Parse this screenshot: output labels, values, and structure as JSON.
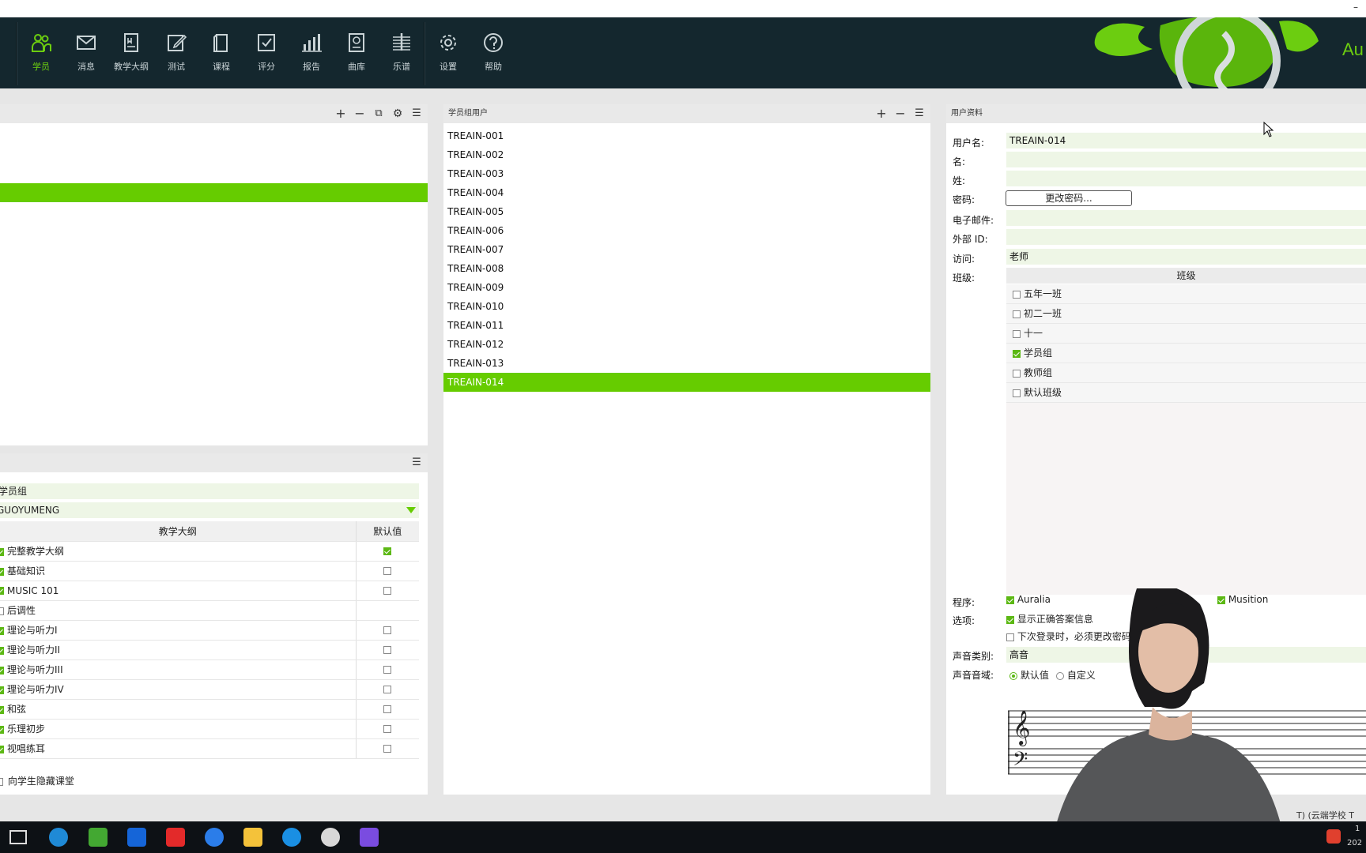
{
  "toolbar": {
    "items": [
      {
        "label": "学员",
        "icon": "users-icon",
        "active": true
      },
      {
        "label": "消息",
        "icon": "mail-icon"
      },
      {
        "label": "教学大纲",
        "icon": "syllabus-icon"
      },
      {
        "label": "测试",
        "icon": "test-icon"
      },
      {
        "label": "课程",
        "icon": "course-icon"
      },
      {
        "label": "评分",
        "icon": "grade-icon"
      },
      {
        "label": "报告",
        "icon": "report-icon"
      },
      {
        "label": "曲库",
        "icon": "library-icon"
      },
      {
        "label": "乐谱",
        "icon": "score-icon"
      }
    ],
    "settings_label": "设置",
    "help_label": "帮助",
    "logo_text": "Au"
  },
  "left_panel": {
    "actions": [
      "+",
      "−",
      "⧉",
      "⚙",
      "☰"
    ]
  },
  "group_panel": {
    "group_name": "学员组",
    "owner": "GUOYUMENG",
    "col_syllabus": "教学大纲",
    "col_default": "默认值",
    "rows": [
      {
        "name": "完整教学大纲",
        "checked": true,
        "default": true,
        "has_default": true
      },
      {
        "name": "基础知识",
        "checked": true,
        "default": false,
        "has_default": true
      },
      {
        "name": "MUSIC 101",
        "checked": true,
        "default": false,
        "has_default": true
      },
      {
        "name": "后调性",
        "checked": false,
        "default": false,
        "has_default": false
      },
      {
        "name": "理论与听力I",
        "checked": true,
        "default": false,
        "has_default": true
      },
      {
        "name": "理论与听力II",
        "checked": true,
        "default": false,
        "has_default": true
      },
      {
        "name": "理论与听力III",
        "checked": true,
        "default": false,
        "has_default": true
      },
      {
        "name": "理论与听力IV",
        "checked": true,
        "default": false,
        "has_default": true
      },
      {
        "name": "和弦",
        "checked": true,
        "default": false,
        "has_default": true
      },
      {
        "name": "乐理初步",
        "checked": true,
        "default": false,
        "has_default": true
      },
      {
        "name": "视唱练耳",
        "checked": true,
        "default": false,
        "has_default": true
      }
    ],
    "hide_label": "向学生隐藏课堂"
  },
  "users_panel": {
    "title": "学员组用户",
    "users": [
      "TREAIN-001",
      "TREAIN-002",
      "TREAIN-003",
      "TREAIN-004",
      "TREAIN-005",
      "TREAIN-006",
      "TREAIN-007",
      "TREAIN-008",
      "TREAIN-009",
      "TREAIN-010",
      "TREAIN-011",
      "TREAIN-012",
      "TREAIN-013",
      "TREAIN-014"
    ],
    "selected": "TREAIN-014"
  },
  "profile": {
    "title": "用户资料",
    "username_label": "用户名:",
    "username": "TREAIN-014",
    "first_label": "名:",
    "last_label": "姓:",
    "password_label": "密码:",
    "change_password": "更改密码...",
    "email_label": "电子邮件:",
    "external_label": "外部 ID:",
    "access_label": "访问:",
    "access": "老师",
    "class_label": "班级:",
    "class_header": "班级",
    "classes": [
      {
        "name": "五年一班",
        "checked": false
      },
      {
        "name": "初二一班",
        "checked": false
      },
      {
        "name": "十一",
        "checked": false
      },
      {
        "name": "学员组",
        "checked": true
      },
      {
        "name": "教师组",
        "checked": false
      },
      {
        "name": "默认班级",
        "checked": false
      }
    ],
    "program_label": "程序:",
    "program_a": "Auralia",
    "program_b": "Musition",
    "options_label": "选项:",
    "option_1": "显示正确答案信息",
    "option_2": "下次登录时，必须更改密码",
    "voice_type_label": "声音类别:",
    "voice_type": "高音",
    "voice_range_label": "声音音域:",
    "range_default": "默认值",
    "range_custom": "自定义"
  },
  "status": {
    "text": "T) (云端学校 T"
  },
  "taskbar": {
    "clock_1": "1",
    "clock_2": "202"
  }
}
